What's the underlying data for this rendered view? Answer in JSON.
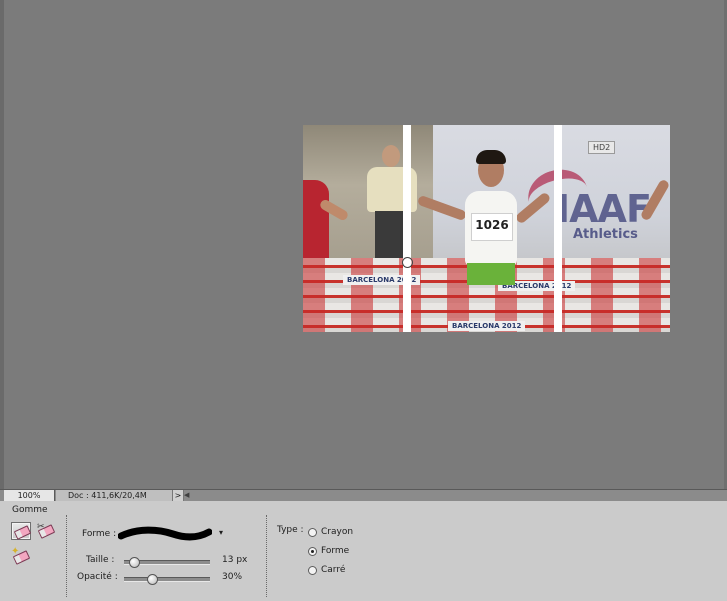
{
  "status_bar": {
    "zoom": "100%",
    "doc_info": "Doc : 411,6K/20,4M",
    "arrow": ">",
    "scroll_arrow": "◀"
  },
  "canvas": {
    "image_banner_1": "BARCELONA 2012",
    "image_banner_2": "BARCELONA 2012",
    "image_banner_3": "BARCELONA 2012",
    "bib_number": "1026",
    "sign_text": "IAAF",
    "sign_subtext": "Athletics",
    "broadcast_logo": "HD2"
  },
  "tool_options": {
    "title": "Gomme",
    "tools": [
      {
        "name": "eraser",
        "selected": true,
        "icon": "eraser-icon"
      },
      {
        "name": "background-eraser",
        "selected": false,
        "icon": "background-eraser-icon"
      },
      {
        "name": "magic-eraser",
        "selected": false,
        "icon": "magic-eraser-icon"
      }
    ],
    "brush_label": "Forme :",
    "brush_dropdown": "▾",
    "size_label": "Taille :",
    "size_value": "13 px",
    "size_fraction": 0.06,
    "opacity_label": "Opacité :",
    "opacity_value": "30%",
    "opacity_fraction": 0.3,
    "type_label": "Type :",
    "type_options": [
      "Crayon",
      "Forme",
      "Carré"
    ],
    "type_selected": "Forme"
  },
  "colors": {
    "workspace": "#7b7b7b",
    "panel": "#cbcbcb",
    "erase_stroke": "#ffffff"
  }
}
